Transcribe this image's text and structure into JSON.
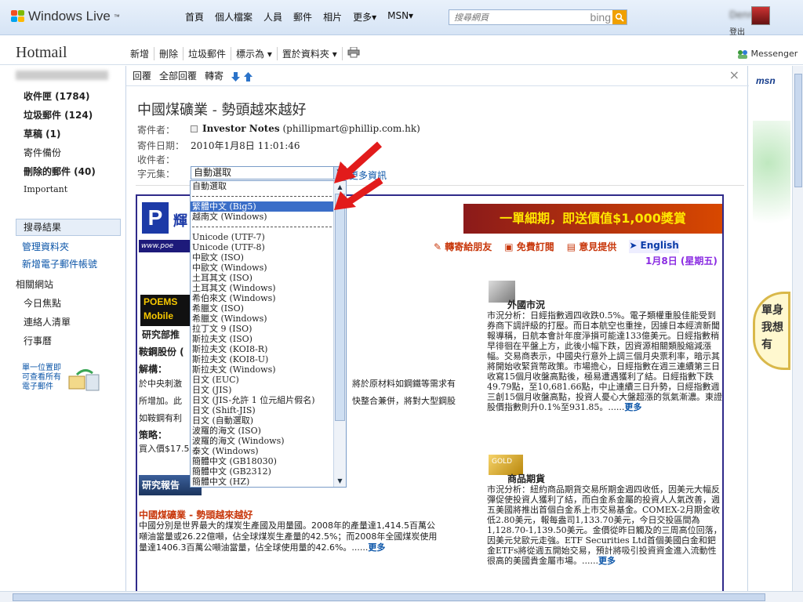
{
  "topbar": {
    "brand": "Windows Live",
    "brand_mark": "™",
    "nav": [
      "首頁",
      "個人檔案",
      "人員",
      "郵件",
      "相片",
      "更多▾",
      "MSN▾"
    ],
    "search_placeholder": "搜尋網頁",
    "search_engine": "bing",
    "user": "Dennis",
    "signout": "登出"
  },
  "hotmail": {
    "title": "Hotmail",
    "toolbar": [
      "新增",
      "刪除",
      "垃圾郵件",
      "標示為 ▾",
      "置於資料夾 ▾"
    ],
    "messenger": "Messenger"
  },
  "sidebar": {
    "folders": [
      {
        "label": "收件匣 (1784)",
        "bold": true
      },
      {
        "label": "垃圾郵件 (124)",
        "bold": true
      },
      {
        "label": "草稿 (1)",
        "bold": true
      },
      {
        "label": "寄件備份",
        "bold": false
      },
      {
        "label": "刪除的郵件 (40)",
        "bold": true
      },
      {
        "label": "Important",
        "bold": false
      }
    ],
    "search_results": "搜尋結果",
    "links": [
      "管理資料夾",
      "新增電子郵件帳號"
    ],
    "related_heading": "相關網站",
    "related": [
      "今日焦點",
      "連絡人清單",
      "行事曆"
    ],
    "promo": [
      "單一位置即",
      "可查看所有",
      "電子郵件"
    ]
  },
  "pane": {
    "toolbar": [
      "回覆",
      "全部回覆",
      "轉寄"
    ],
    "close": "×",
    "subject": "中國煤礦業 - 勢頭越來越好",
    "labels": {
      "from": "寄件者：",
      "date": "寄件日期：",
      "to": "收件者：",
      "charset": "字元集："
    },
    "from_name": "Investor Notes",
    "from_email": "(phillipmart@phillip.com.hk)",
    "date": "2010年1月8日 11:01:46",
    "to": "",
    "charset_selected": "自動選取",
    "more_info": "更多資訊"
  },
  "charset_options": [
    "自動選取",
    "---",
    "繁體中文 (Big5)",
    "越南文 (Windows)",
    "---",
    "Unicode (UTF-7)",
    "Unicode (UTF-8)",
    "中歐文 (ISO)",
    "中歐文 (Windows)",
    "土耳其文 (ISO)",
    "土耳其文 (Windows)",
    "希伯來文 (Windows)",
    "希臘文 (ISO)",
    "希臘文 (Windows)",
    "拉丁文 9 (ISO)",
    "斯拉夫文 (ISO)",
    "斯拉夫文 (KOI8-R)",
    "斯拉夫文 (KOI8-U)",
    "斯拉夫文 (Windows)",
    "日文 (EUC)",
    "日文 (JIS)",
    "日文 (JIS-允許 1 位元組片假名)",
    "日文 (Shift-JIS)",
    "日文 (自動選取)",
    "波羅的海文 (ISO)",
    "波羅的海文 (Windows)",
    "泰文 (Windows)",
    "簡體中文 (GB18030)",
    "簡體中文 (GB2312)",
    "簡體中文 (HZ)"
  ],
  "charset_selected_index": 2,
  "newsletter": {
    "logo_letter": "P",
    "logo_text": "輝",
    "url": "www.poe",
    "banner": "一單細期，即送價值$1,000獎賞",
    "links": [
      "轉寄給朋友",
      "免費訂閱",
      "意見提供",
      "English"
    ],
    "date": "1月8日 (星期五)",
    "poems_line1": "POEMS",
    "poems_line2": "Mobile",
    "research_dept": "研究部推",
    "stock_name": "鞍鋼股份 (",
    "explain_label": "解構：",
    "explain_text_1": "於中央刺激",
    "explain_text_1b": "將於原材料如鋼鐵等需求有",
    "explain_text_2": "所增加。此",
    "explain_text_2b": "快整合兼併，將對大型鋼股",
    "explain_text_3": "如鞍鋼有利",
    "strategy_label": "策略：",
    "strategy_text": "買入價$17.5",
    "research_tag": "研究報告",
    "article_title": "中國煤礦業 - 勢頭越來越好",
    "article_1": "中國分別是世界最大的煤炭生產國及用量國。2008年的產量達1,414.5百萬公",
    "article_2": "噸油當量或26.22億噸，佔全球煤炭生產量的42.5%；而2008年全國煤炭使用",
    "article_3": "量達1406.3百萬公噸油當量，佔全球使用量的42.6%。......",
    "more": "更多",
    "foreign_title": "外國市況",
    "foreign_text": "市況分析：日經指數週四收跌0.5%。電子類權重股佳能受到券商下調評級的打壓。而日本航空也重挫，因據日本經濟新聞報導稱，日航本會計年度淨損可能達133億美元。日經指數稍早徘徊在平盤上方，此後小幅下跌，因資源相關類股縮減漲幅。交易商表示，中國央行意外上調三個月央票利率，暗示其將開始收緊貨幣政策。市場擔心，日經指數在週三連續第三日收寫15個月收盤高點後，極易遭遇獲利了結。日經指數下跌49.79點，至10,681.66點，中止連續三日升勢，日經指數週三創15個月收盤高點，投資人憂心大盤超漲的氛氣漸濃。東證股價指數則升0.1%至931.85。......",
    "commodity_title": "商品期貨",
    "commodity_text": "市況分析：紐約商品期貨交易所期金週四收低，因美元大幅反彈促使投資人獲利了結，而白金系金屬的投資人人氣改善，週五美國將推出首個白金系上市交易基金。COMEX-2月期金收低2.80美元，報每盎司1,133.70美元，今日交投區間為1,128.70-1,139.50美元。金價從昨日觸及的三周高位回落，因美元兌歐元走強。ETF Securities Ltd首個美國白金和鈀金ETFs將從週五開始交易，預計將吸引投資資金進入流動性很高的美國貴金屬市場。......",
    "gold_label": "GOLD"
  },
  "ads": {
    "msn": "msn",
    "bubble": [
      "單身",
      "我想",
      "有"
    ]
  }
}
